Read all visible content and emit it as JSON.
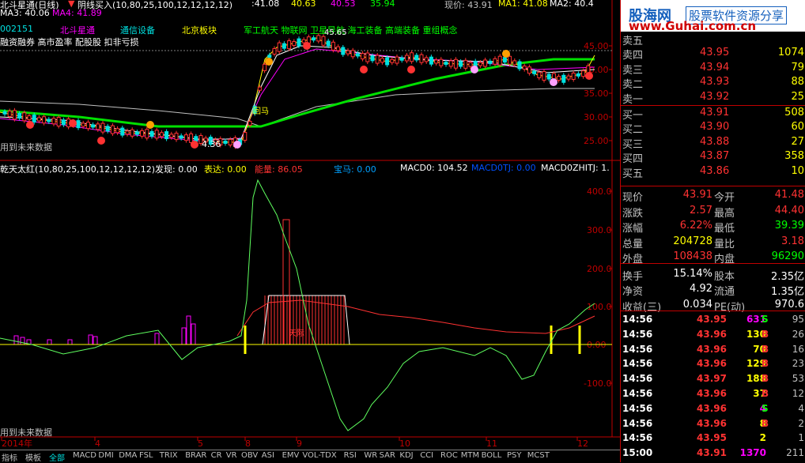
{
  "window": {
    "title": "北斗星通(日线)",
    "indicator_top": "阴线买入(10,80,25,100,12,12,12,12)",
    "ma_row1": [
      ":41.08",
      "40.63",
      "40.53",
      "35.94"
    ],
    "cur_price_label": "现价: 43.91",
    "ma1": "MA1: 41.08",
    "ma2": "MA2: 40.4"
  },
  "ma_row2": {
    "ma3": "MA3: 40.06",
    "ma4": "MA4: 41.89"
  },
  "stock_info": {
    "code": "002151",
    "name": "北斗星通",
    "industry": "通信设备",
    "board": "北京板块",
    "concepts": "军工航天 物联网 卫星导航 海工装备 高端装备 重组概念",
    "tags": "融资融券 高市盈率 配股股 扣非亏损",
    "price_peak": "45.65"
  },
  "chart_notes": {
    "low_price": "4.36",
    "future_note_1": "用到未来数据",
    "future_note_2": "用到未来数据",
    "left_tag": "回马",
    "mid_tag": "天际"
  },
  "indicator_lower": {
    "name": "乾天太红(10,80,25,100,12,12,12,12)",
    "fx": "发现: 0.00",
    "bd": "表达: 0.00",
    "nl": "能量: 86.05",
    "bm": "宝马: 0.00",
    "macd0": "MACD0: 104.52",
    "macd0tj": "MACD0TJ: 0.00",
    "macd0zhitj": "MACD0ZHITJ: 1."
  },
  "upper_axis": [
    "45.00",
    "40.00",
    "35.00",
    "30.00",
    "25.00"
  ],
  "lower_axis": [
    "400.0",
    "300.0",
    "200.0",
    "100.0",
    "0.00",
    "-100.0"
  ],
  "x_axis": [
    "2014年",
    "4",
    "5",
    "8",
    "9",
    "10",
    "11",
    "12",
    "日线"
  ],
  "logo": {
    "main": "股海网",
    "tag": "股票软件资源分享",
    "url": "www.Guhai.com.cn"
  },
  "order_book": {
    "asks": [
      {
        "label": "卖五",
        "price": "",
        "vol": ""
      },
      {
        "label": "卖四",
        "price": "43.95",
        "vol": "1074"
      },
      {
        "label": "卖三",
        "price": "43.94",
        "vol": "79"
      },
      {
        "label": "卖二",
        "price": "43.93",
        "vol": "88"
      },
      {
        "label": "卖一",
        "price": "43.92",
        "vol": "25"
      }
    ],
    "bids": [
      {
        "label": "买一",
        "price": "43.91",
        "vol": "508"
      },
      {
        "label": "买二",
        "price": "43.90",
        "vol": "60"
      },
      {
        "label": "买三",
        "price": "43.88",
        "vol": "27"
      },
      {
        "label": "买四",
        "price": "43.87",
        "vol": "358"
      },
      {
        "label": "买五",
        "price": "43.86",
        "vol": "10"
      }
    ]
  },
  "quote": [
    {
      "l1": "现价",
      "v1": "43.91",
      "l2": "今开",
      "v2": "41.48"
    },
    {
      "l1": "涨跌",
      "v1": "2.57",
      "l2": "最高",
      "v2": "44.40"
    },
    {
      "l1": "涨幅",
      "v1": "6.22%",
      "l2": "最低",
      "v2": "39.39"
    },
    {
      "l1": "总量",
      "v1": "204728",
      "l2": "量比",
      "v2": "3.18"
    },
    {
      "l1": "外盘",
      "v1": "108438",
      "l2": "内盘",
      "v2": "96290"
    },
    {
      "l1": "换手",
      "v1": "15.14%",
      "l2": "股本",
      "v2": "2.35亿"
    },
    {
      "l1": "净资",
      "v1": "4.92",
      "l2": "流通",
      "v2": "1.35亿"
    },
    {
      "l1": "收益(三)",
      "v1": "0.034",
      "l2": "PE(动)",
      "v2": "970.6"
    }
  ],
  "ticks": [
    {
      "time": "14:56",
      "price": "43.95",
      "vol": "631",
      "bs": "S",
      "n": "95"
    },
    {
      "time": "14:56",
      "price": "43.96",
      "vol": "130",
      "bs": "B",
      "n": "26"
    },
    {
      "time": "14:56",
      "price": "43.96",
      "vol": "70",
      "bs": "B",
      "n": "16"
    },
    {
      "time": "14:56",
      "price": "43.96",
      "vol": "129",
      "bs": "B",
      "n": "23"
    },
    {
      "time": "14:56",
      "price": "43.97",
      "vol": "188",
      "bs": "B",
      "n": "53"
    },
    {
      "time": "14:56",
      "price": "43.96",
      "vol": "37",
      "bs": "B",
      "n": "12"
    },
    {
      "time": "14:56",
      "price": "43.96",
      "vol": "4",
      "bs": "S",
      "n": "4"
    },
    {
      "time": "14:56",
      "price": "43.96",
      "vol": "8",
      "bs": "B",
      "n": "2"
    },
    {
      "time": "14:56",
      "price": "43.95",
      "vol": "2",
      "bs": "",
      "n": "1"
    },
    {
      "time": "15:00",
      "price": "43.91",
      "vol": "1370",
      "bs": "",
      "n": "211"
    }
  ],
  "bottom_tabs": [
    "指标",
    "模板",
    "全部",
    "MACD",
    "DMI",
    "DMA",
    "FSL",
    "TRIX",
    "BRAR",
    "CR",
    "VR",
    "OBV",
    "ASI",
    "EMV",
    "VOL-TDX",
    "RSI",
    "WR",
    "SAR",
    "KDJ",
    "CCI",
    "ROC",
    "MTM",
    "BOLL",
    "PSY",
    "MCST"
  ],
  "colors": {
    "up": "#ff3232",
    "down": "#00e0e0",
    "axis": "#c00000",
    "macd_green": "#5fff5f",
    "yellow": "#ffff00"
  }
}
